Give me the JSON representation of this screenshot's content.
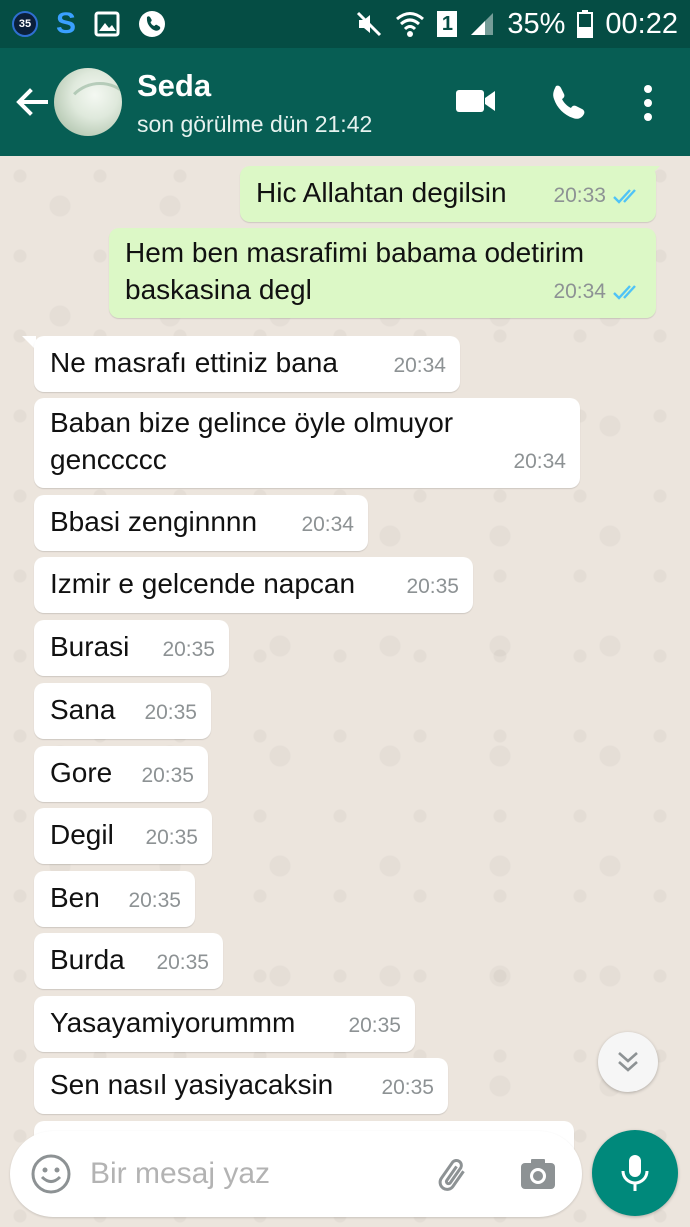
{
  "status_bar": {
    "notification_badge": "35",
    "battery": "35%",
    "time": "00:22",
    "sim_indicator": "1",
    "icons": [
      "notification-badge-icon",
      "s-app-icon",
      "gallery-icon",
      "phone-icon",
      "mute-icon",
      "wifi-icon",
      "signal-icon",
      "battery-icon"
    ]
  },
  "header": {
    "contact_name": "Seda",
    "last_seen": "son görülme dün 21:42",
    "icons": [
      "back-arrow-icon",
      "video-call-icon",
      "voice-call-icon",
      "more-options-icon"
    ],
    "color": "#075E54",
    "status_bar_color": "#054D44"
  },
  "messages": [
    {
      "dir": "out",
      "text": "Hic Allahtan degilsin",
      "time": "20:33",
      "status": "read"
    },
    {
      "dir": "out",
      "text": "Hem ben masrafimi babama odetirim baskasina degl",
      "time": "20:34",
      "status": "read"
    },
    {
      "dir": "in",
      "text": "Ne masrafı ettiniz bana",
      "time": "20:34"
    },
    {
      "dir": "in",
      "text": "Baban bize gelince öyle olmuyor genccccc",
      "time": "20:34"
    },
    {
      "dir": "in",
      "text": "Bbasi zenginnnn",
      "time": "20:34"
    },
    {
      "dir": "in",
      "text": "Izmir e gelcende napcan",
      "time": "20:35"
    },
    {
      "dir": "in",
      "text": "Burasi",
      "time": "20:35"
    },
    {
      "dir": "in",
      "text": "Sana",
      "time": "20:35"
    },
    {
      "dir": "in",
      "text": "Gore",
      "time": "20:35"
    },
    {
      "dir": "in",
      "text": "Degil",
      "time": "20:35"
    },
    {
      "dir": "in",
      "text": "Ben",
      "time": "20:35"
    },
    {
      "dir": "in",
      "text": "Burda",
      "time": "20:35"
    },
    {
      "dir": "in",
      "text": "Yasayamiyorummm",
      "time": "20:35"
    },
    {
      "dir": "in",
      "text": "Sen nasıl yasiyacaksin",
      "time": "20:35"
    }
  ],
  "input": {
    "placeholder": "Bir mesaj yaz",
    "value": "",
    "icons": [
      "emoji-icon",
      "attach-icon",
      "camera-icon",
      "mic-icon",
      "scroll-down-icon"
    ]
  },
  "colors": {
    "outgoing_bubble": "#DCF8C6",
    "incoming_bubble": "#FFFFFF",
    "chat_background": "#ECE5DD",
    "read_ticks": "#4FC3F7",
    "mic_button": "#00897B"
  }
}
